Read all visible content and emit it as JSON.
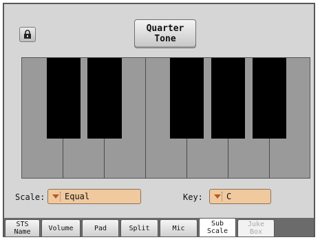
{
  "quarter_tone_button": {
    "line1": "Quarter",
    "line2": "Tone"
  },
  "lock_icon": "lock-icon",
  "scale": {
    "label": "Scale:",
    "value": "Equal"
  },
  "key": {
    "label": "Key:",
    "value": "C"
  },
  "tabs": [
    {
      "line1": "STS",
      "line2": "Name",
      "state": "normal"
    },
    {
      "line1": "Volume",
      "line2": "",
      "state": "normal"
    },
    {
      "line1": "Pad",
      "line2": "",
      "state": "normal"
    },
    {
      "line1": "Split",
      "line2": "",
      "state": "normal"
    },
    {
      "line1": "Mic",
      "line2": "",
      "state": "normal"
    },
    {
      "line1": "Sub",
      "line2": "Scale",
      "state": "active"
    },
    {
      "line1": "Juke",
      "line2": "Box",
      "state": "disabled"
    }
  ],
  "colors": {
    "frame_bg": "#d6d6d6",
    "key_white": "#9a9a9a",
    "key_black": "#000000",
    "dropdown_bg": "#f1c99e"
  }
}
